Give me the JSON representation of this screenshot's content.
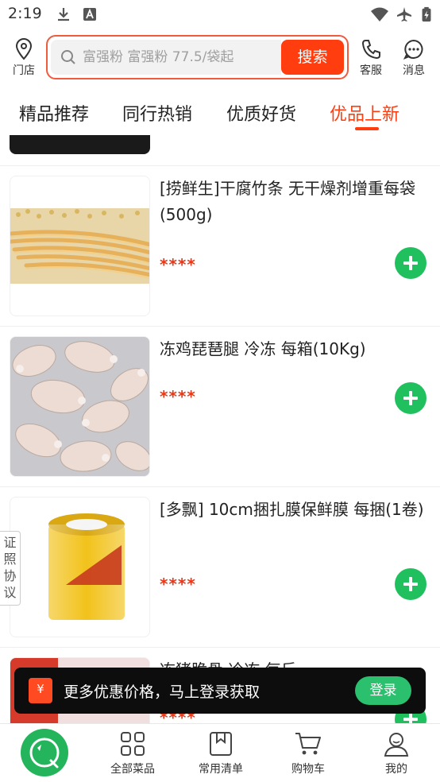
{
  "status_bar": {
    "time": "2:19"
  },
  "header": {
    "store_label": "门店",
    "search_placeholder": "富强粉 富强粉 77.5/袋起",
    "search_button": "搜索",
    "service_label": "客服",
    "message_label": "消息"
  },
  "tabs": [
    {
      "label": "精品推荐",
      "active": false
    },
    {
      "label": "同行热销",
      "active": false
    },
    {
      "label": "优质好货",
      "active": false
    },
    {
      "label": "优品上新",
      "active": true
    }
  ],
  "products": [
    {
      "title": "[捞鲜生]干腐竹条 无干燥剂增重每袋(500g)",
      "price": "****"
    },
    {
      "title": "冻鸡琵琶腿 冷冻 每箱(10Kg)",
      "price": "****"
    },
    {
      "title": "[多飘] 10cm捆扎膜保鲜膜 每捆(1卷)",
      "price": "****"
    },
    {
      "title": "冻猪脆骨 冷冻 每斤",
      "price": "****"
    }
  ],
  "side_tab": "证照协议",
  "login_banner": {
    "icon": "¥",
    "message": "更多优惠价格，马上登录获取",
    "button": "登录"
  },
  "bottom_nav": [
    {
      "label": "全部菜品",
      "icon": "grid-icon"
    },
    {
      "label": "常用清单",
      "icon": "bookmark-icon"
    },
    {
      "label": "购物车",
      "icon": "cart-icon"
    },
    {
      "label": "我的",
      "icon": "user-icon"
    }
  ],
  "colors": {
    "accent": "#ff3d0f",
    "green": "#1fc05d",
    "price": "#e4391b"
  }
}
